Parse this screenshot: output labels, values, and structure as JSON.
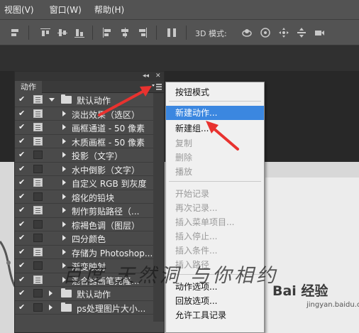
{
  "menubar": {
    "items": [
      "视图(V)",
      "窗口(W)",
      "帮助(H)"
    ]
  },
  "toolbar": {
    "mode_3d_label": "3D 模式:"
  },
  "actions_panel": {
    "tab_label": "动作",
    "collapse_glyph": "◂◂",
    "close_glyph": "✕",
    "rows": [
      {
        "label": "默认动作",
        "type": "set",
        "expanded": true,
        "dialog": true
      },
      {
        "label": "淡出效果（选区）",
        "type": "action",
        "dialog": true
      },
      {
        "label": "画框通道 - 50 像素",
        "type": "action",
        "dialog": true
      },
      {
        "label": "木质画框 - 50 像素",
        "type": "action",
        "dialog": true
      },
      {
        "label": "投影（文字）",
        "type": "action",
        "dialog": false
      },
      {
        "label": "水中倒影（文字）",
        "type": "action",
        "dialog": false
      },
      {
        "label": "自定义 RGB 到灰度",
        "type": "action",
        "dialog": true
      },
      {
        "label": "熔化的铅块",
        "type": "action",
        "dialog": false
      },
      {
        "label": "制作剪贴路径（...",
        "type": "action",
        "dialog": true
      },
      {
        "label": "棕褐色调（图层）",
        "type": "action",
        "dialog": false
      },
      {
        "label": "四分颜色",
        "type": "action",
        "dialog": false
      },
      {
        "label": "存储为 Photoshop...",
        "type": "action",
        "dialog": true
      },
      {
        "label": "渐变映射",
        "type": "action",
        "dialog": false
      },
      {
        "label": "混合器画笔克隆...",
        "type": "action",
        "dialog": true
      },
      {
        "label": "默认动作",
        "type": "set",
        "expanded": false,
        "dialog": false
      },
      {
        "label": "ps处理图片大小...",
        "type": "set",
        "expanded": false,
        "dialog": false
      }
    ]
  },
  "flyout_menu": {
    "items": [
      {
        "label": "按钮模式",
        "state": "normal"
      },
      {
        "label": "新建动作...",
        "state": "highlighted"
      },
      {
        "label": "新建组...",
        "state": "normal"
      },
      {
        "label": "复制",
        "state": "disabled"
      },
      {
        "label": "删除",
        "state": "disabled"
      },
      {
        "label": "播放",
        "state": "disabled"
      },
      {
        "label": "开始记录",
        "state": "disabled"
      },
      {
        "label": "再次记录...",
        "state": "disabled"
      },
      {
        "label": "插入菜单项目...",
        "state": "disabled"
      },
      {
        "label": "插入停止...",
        "state": "disabled"
      },
      {
        "label": "插入条件...",
        "state": "disabled"
      },
      {
        "label": "插入路径",
        "state": "disabled"
      },
      {
        "label": "动作选项...",
        "state": "normal"
      },
      {
        "label": "回放选项...",
        "state": "normal"
      },
      {
        "label": "允许工具记录",
        "state": "normal"
      }
    ]
  },
  "watermark": {
    "text": "百度 天然洞 与你相约"
  },
  "logo": {
    "text": "Bai 经验",
    "sub": "jingyan.baidu.com"
  },
  "colors": {
    "menu_highlight": "#3b87e0",
    "arrow": "#e8322f",
    "panel_bg": "#4a4a4a"
  }
}
